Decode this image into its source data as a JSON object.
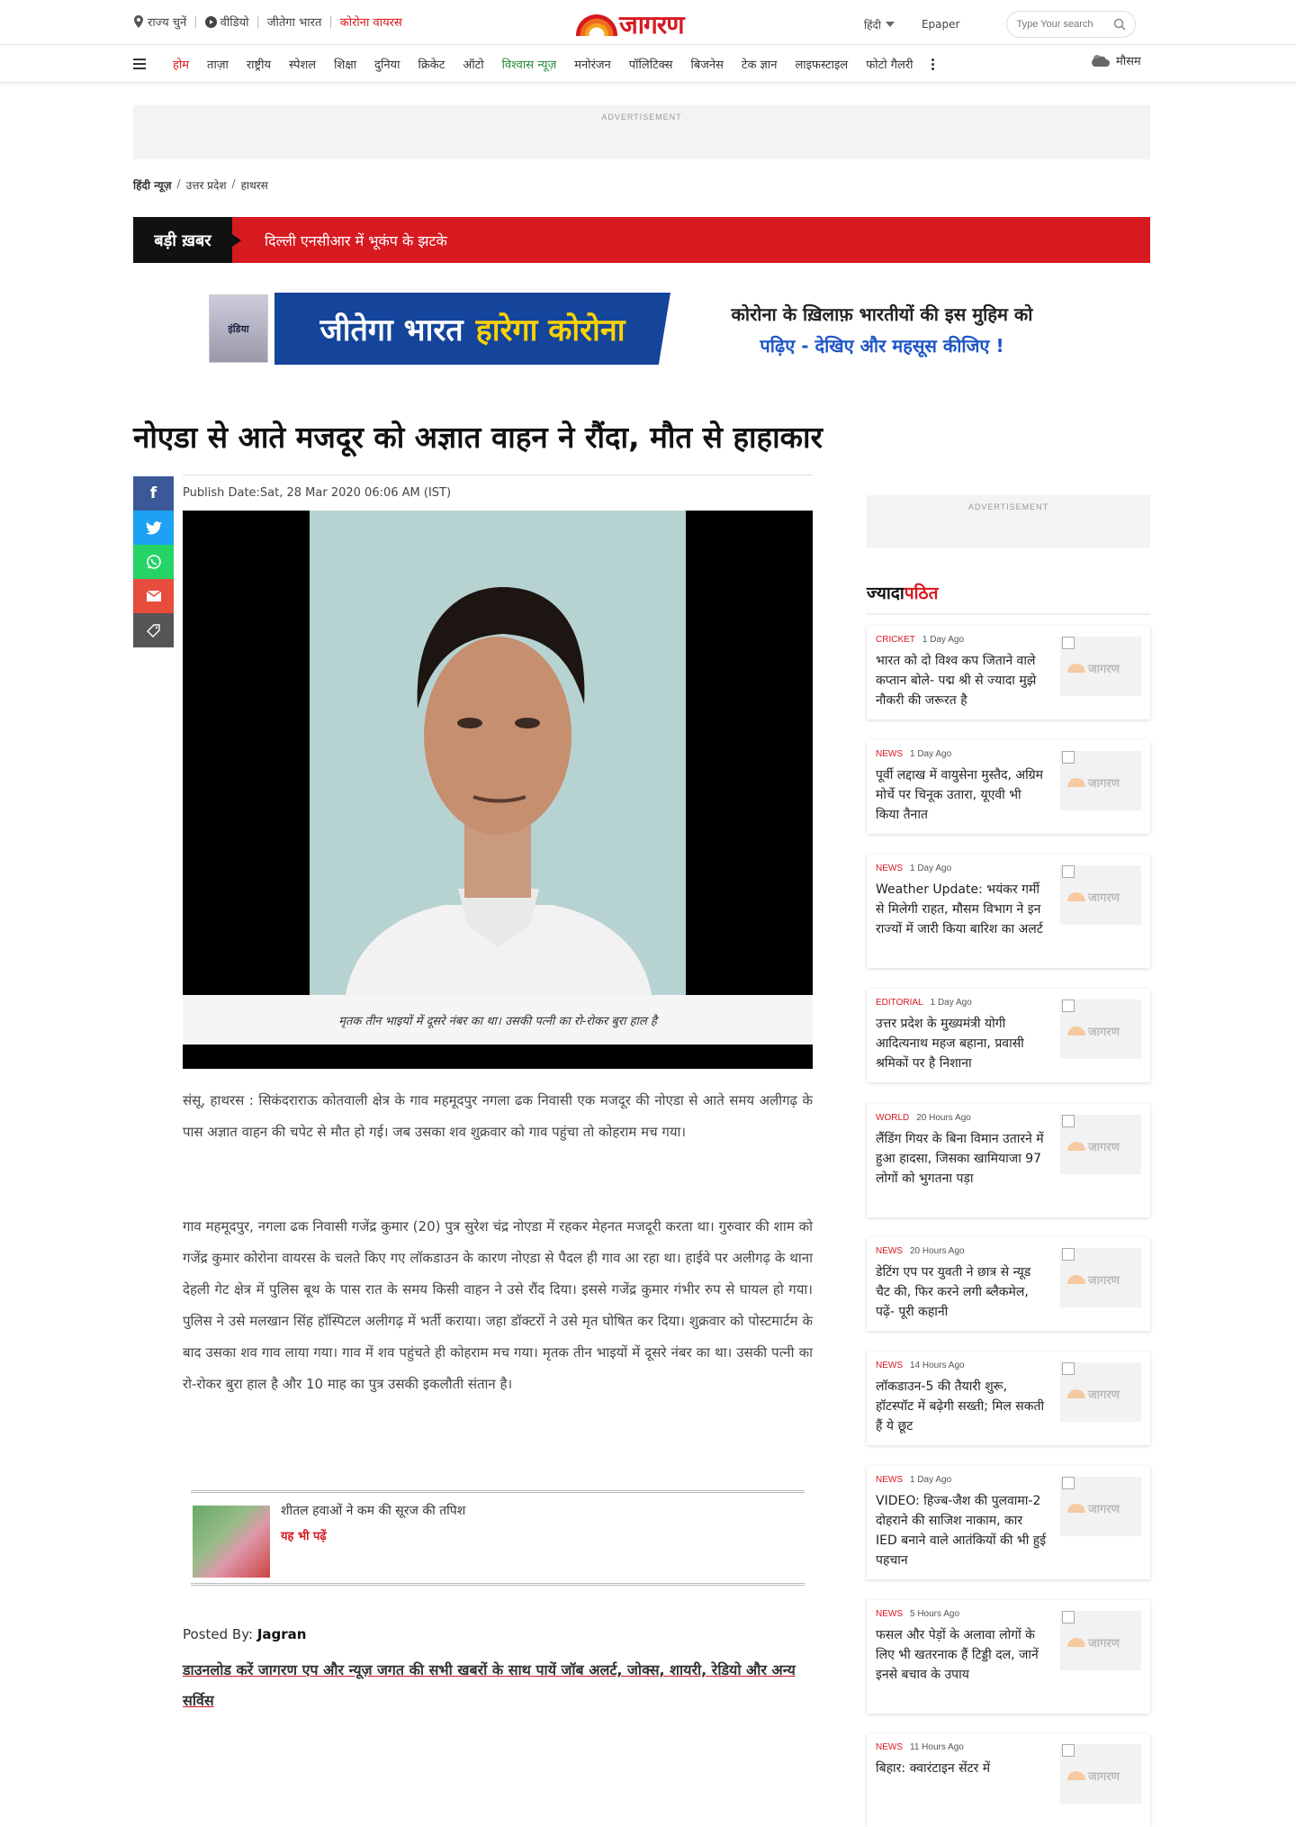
{
  "header": {
    "state_select": "राज्य चुनें",
    "video": "वीडियो",
    "jeetega_bharat": "जीतेगा भारत",
    "corona": "कोरोना वायरस",
    "logo": "जागरण",
    "language": "हिंदी",
    "epaper": "Epaper",
    "search_placeholder": "Type Your search"
  },
  "nav": {
    "items": [
      "होम",
      "ताज़ा",
      "राष्ट्रीय",
      "स्पेशल",
      "शिक्षा",
      "दुनिया",
      "क्रिकेट",
      "ऑटो",
      "विश्वास न्यूज़",
      "मनोरंजन",
      "पॉलिटिक्स",
      "बिजनेस",
      "टेक ज्ञान",
      "लाइफस्टाइल",
      "फोटो गैलरी"
    ],
    "weather": "मौसम"
  },
  "ads": {
    "label": "ADVERTISEMENT"
  },
  "breadcrumb": [
    "हिंदी न्यूज़",
    "उत्तर प्रदेश",
    "हाथरस"
  ],
  "breaking": {
    "label": "बड़ी ख़बर",
    "text": "दिल्ली एनसीआर में भूकंप के झटके"
  },
  "banner": {
    "thumb_text": "इंडिया",
    "left_text": "जीतेगा भारत",
    "left_highlight": "हारेगा कोरोना",
    "line1": "कोरोना के ख़िलाफ़ भारतीयों की इस मुहिम को",
    "line2": "पढ़िए - देखिए और महसूस कीजिए !"
  },
  "article": {
    "headline": "नोएडा से आते मजदूर को अज्ञात वाहन ने रौंदा, मौत से हाहाकार",
    "publish_date": "Publish Date:Sat, 28 Mar 2020 06:06 AM (IST)",
    "caption": "मृतक तीन भाइयों में दूसरे नंबर का था। उसकी पत्नी का रो-रोकर बुरा हाल है",
    "para1": "संसू, हाथरस : सिकंदराराऊ कोतवाली क्षेत्र के गाव महमूदपुर नगला ढक निवासी एक मजदूर की नोएडा से आते समय अलीगढ़ के पास अज्ञात वाहन की चपेट से मौत हो गई। जब उसका शव शुक्रवार को गाव पहुंचा तो कोहराम मच गया।",
    "para2": "गाव महमूदपुर, नगला ढक निवासी गजेंद्र कुमार (20) पुत्र सुरेश चंद्र नोएडा में रहकर मेहनत मजदूरी करता था। गुरुवार की शाम को गजेंद्र कुमार कोरोना वायरस के चलते किए गए लॉकडाउन के कारण नोएडा से पैदल ही गाव आ रहा था। हाईवे पर अलीगढ़ के थाना देहली गेट क्षेत्र में पुलिस बूथ के पास रात के समय किसी वाहन ने उसे रौंद दिया। इससे गजेंद्र कुमार गंभीर रुप से घायल हो गया। पुलिस ने उसे मलखान सिंह हॉस्पिटल अलीगढ़ में भर्ती कराया। जहा डॉक्टरों ने उसे मृत घोषित कर दिया। शुक्रवार को पोस्टमार्टम के बाद उसका शव गाव लाया गया। गाव में शव पहुंचते ही कोहराम मच गया। मृतक तीन भाइयों में दूसरे नंबर का था। उसकी पत्नी का रो-रोकर बुरा हाल है और 10 माह का पुत्र उसकी इकलौती संतान है।",
    "related_title": "शीतल हवाओं ने कम की सूरज की तपिश",
    "related_link": "यह भी पढ़ें",
    "posted_by_label": "Posted By:",
    "posted_by": "Jagran",
    "download": "डाउनलोड करें जागरण एप और न्यूज़ जगत की सभी खबरों के साथ पायें जॉब अलर्ट, जोक्स, शायरी, रेडियो और अन्य सर्विस"
  },
  "sidebar": {
    "heading_a": "ज्यादा",
    "heading_b": "पठित",
    "logo_text": "जागरण",
    "cards": [
      {
        "cat": "CRICKET",
        "ago": "1 Day Ago",
        "title": "भारत को दो विश्व कप जिताने वाले कप्तान बोले- पद्म श्री से ज्यादा मुझे नौकरी की जरूरत है"
      },
      {
        "cat": "NEWS",
        "ago": "1 Day Ago",
        "title": "पूर्वी लद्दाख में वायुसेना मुस्तैद, अग्रिम मोर्चे पर चिनूक उतारा, यूएवी भी किया तैनात"
      },
      {
        "cat": "NEWS",
        "ago": "1 Day Ago",
        "title": "Weather Update: भयंकर गर्मी से मिलेगी राहत, मौसम विभाग ने इन राज्यों में जारी किया बारिश का अलर्ट"
      },
      {
        "cat": "EDITORIAL",
        "ago": "1 Day Ago",
        "title": "उत्तर प्रदेश के मुख्यमंत्री योगी आदित्यनाथ महज बहाना, प्रवासी श्रमिकों पर है निशाना"
      },
      {
        "cat": "WORLD",
        "ago": "20 Hours Ago",
        "title": "लैंडिंग गियर के बिना विमान उतारने में हुआ हादसा, जिसका खामियाजा 97 लोगों को भुगतना पड़ा"
      },
      {
        "cat": "NEWS",
        "ago": "20 Hours Ago",
        "title": "डेटिंग एप पर युवती ने छात्र से न्यूड चैट की, फिर करने लगी ब्लैकमेल, पढ़ें- पूरी कहानी"
      },
      {
        "cat": "NEWS",
        "ago": "14 Hours Ago",
        "title": "लॉकडाउन-5 की तैयारी शुरू, हॉटस्पॉट में बढ़ेगी सख्ती; मिल सकती हैं ये छूट"
      },
      {
        "cat": "NEWS",
        "ago": "1 Day Ago",
        "title": "VIDEO: हिज्ब-जैश की पुलवामा-2 दोहराने की साजिश नाकाम, कार IED बनाने वाले आतंकियों की भी हुई पहचान"
      },
      {
        "cat": "NEWS",
        "ago": "5 Hours Ago",
        "title": "फसल और पेड़ों के अलावा लोगों के लिए भी खतरनाक हैं टिड्डी दल, जानें इनसे बचाव के उपाय"
      },
      {
        "cat": "NEWS",
        "ago": "11 Hours Ago",
        "title": "बिहार: क्वारंटाइन सेंटर में"
      }
    ]
  },
  "colors": {
    "brand_red": "#d71920",
    "facebook": "#3b5998",
    "twitter": "#1da1f2",
    "whatsapp": "#25d366",
    "email": "#e74c3c",
    "tag": "#555555"
  },
  "icons": [
    "location-icon",
    "video-play-icon",
    "search-icon",
    "menu-icon",
    "more-icon",
    "weather-icon",
    "facebook-icon",
    "twitter-icon",
    "whatsapp-icon",
    "email-icon",
    "tag-icon"
  ]
}
